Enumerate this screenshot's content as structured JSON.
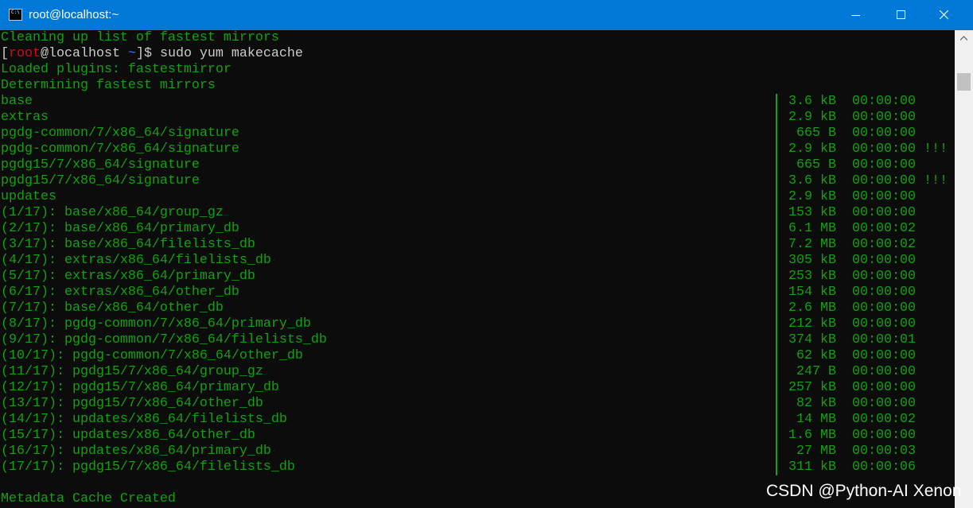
{
  "window": {
    "title": "root@localhost:~",
    "icon_text": "C:\\",
    "controls": [
      "minimize-icon",
      "maximize-icon",
      "close-icon"
    ],
    "titlebar_color": "#0078d7"
  },
  "colors": {
    "background": "#0c0c0c",
    "text_green": "#13a10e",
    "prompt_red": "#c50f1f",
    "prompt_blue": "#3b78ff"
  },
  "terminal": {
    "line_pre": "Cleaning up list of fastest mirrors",
    "prompt": {
      "open": "[",
      "user": "root",
      "at": "@",
      "host": "localhost",
      "dir": "~",
      "close": "]$",
      "command": "sudo yum makecache"
    },
    "line_plugins": "Loaded plugins: fastestmirror",
    "line_determining": "Determining fastest mirrors",
    "rows": [
      {
        "name": "base",
        "size": "3.6 kB",
        "time": "00:00:00",
        "flag": ""
      },
      {
        "name": "extras",
        "size": "2.9 kB",
        "time": "00:00:00",
        "flag": ""
      },
      {
        "name": "pgdg-common/7/x86_64/signature",
        "size": "665 B",
        "time": "00:00:00",
        "flag": ""
      },
      {
        "name": "pgdg-common/7/x86_64/signature",
        "size": "2.9 kB",
        "time": "00:00:00",
        "flag": "!!!"
      },
      {
        "name": "pgdg15/7/x86_64/signature",
        "size": "665 B",
        "time": "00:00:00",
        "flag": ""
      },
      {
        "name": "pgdg15/7/x86_64/signature",
        "size": "3.6 kB",
        "time": "00:00:00",
        "flag": "!!!"
      },
      {
        "name": "updates",
        "size": "2.9 kB",
        "time": "00:00:00",
        "flag": ""
      },
      {
        "name": "(1/17): base/x86_64/group_gz",
        "size": "153 kB",
        "time": "00:00:00",
        "flag": ""
      },
      {
        "name": "(2/17): base/x86_64/primary_db",
        "size": "6.1 MB",
        "time": "00:00:02",
        "flag": ""
      },
      {
        "name": "(3/17): base/x86_64/filelists_db",
        "size": "7.2 MB",
        "time": "00:00:02",
        "flag": ""
      },
      {
        "name": "(4/17): extras/x86_64/filelists_db",
        "size": "305 kB",
        "time": "00:00:00",
        "flag": ""
      },
      {
        "name": "(5/17): extras/x86_64/primary_db",
        "size": "253 kB",
        "time": "00:00:00",
        "flag": ""
      },
      {
        "name": "(6/17): extras/x86_64/other_db",
        "size": "154 kB",
        "time": "00:00:00",
        "flag": ""
      },
      {
        "name": "(7/17): base/x86_64/other_db",
        "size": "2.6 MB",
        "time": "00:00:00",
        "flag": ""
      },
      {
        "name": "(8/17): pgdg-common/7/x86_64/primary_db",
        "size": "212 kB",
        "time": "00:00:00",
        "flag": ""
      },
      {
        "name": "(9/17): pgdg-common/7/x86_64/filelists_db",
        "size": "374 kB",
        "time": "00:00:01",
        "flag": ""
      },
      {
        "name": "(10/17): pgdg-common/7/x86_64/other_db",
        "size": "62 kB",
        "time": "00:00:00",
        "flag": ""
      },
      {
        "name": "(11/17): pgdg15/7/x86_64/group_gz",
        "size": "247 B",
        "time": "00:00:00",
        "flag": ""
      },
      {
        "name": "(12/17): pgdg15/7/x86_64/primary_db",
        "size": "257 kB",
        "time": "00:00:00",
        "flag": ""
      },
      {
        "name": "(13/17): pgdg15/7/x86_64/other_db",
        "size": "82 kB",
        "time": "00:00:00",
        "flag": ""
      },
      {
        "name": "(14/17): updates/x86_64/filelists_db",
        "size": "14 MB",
        "time": "00:00:02",
        "flag": ""
      },
      {
        "name": "(15/17): updates/x86_64/other_db",
        "size": "1.6 MB",
        "time": "00:00:00",
        "flag": ""
      },
      {
        "name": "(16/17): updates/x86_64/primary_db",
        "size": "27 MB",
        "time": "00:00:03",
        "flag": ""
      },
      {
        "name": "(17/17): pgdg15/7/x86_64/filelists_db",
        "size": "311 kB",
        "time": "00:00:06",
        "flag": ""
      }
    ],
    "line_blank": "",
    "line_final": "Metadata Cache Created"
  },
  "watermark": "CSDN @Python-AI Xenon"
}
